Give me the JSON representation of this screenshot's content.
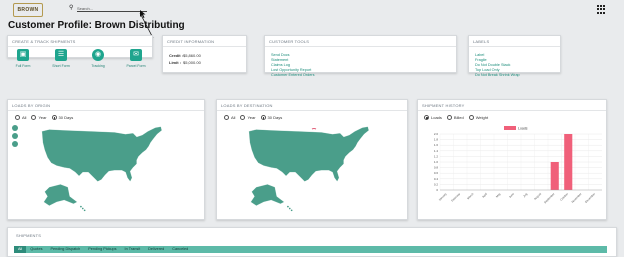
{
  "header": {
    "logo_text": "BROWN",
    "search_placeholder": "Search...",
    "page_title": "Customer Profile: Brown Distributing"
  },
  "ship_card": {
    "title": "CREATE & TRACK SHIPMENTS",
    "buttons": [
      {
        "label": "Full Form",
        "icon": "box-icon"
      },
      {
        "label": "Short Form",
        "icon": "clipboard-icon"
      },
      {
        "label": "Tracking",
        "icon": "globe-icon"
      },
      {
        "label": "Parcel Form",
        "icon": "envelope-icon"
      }
    ]
  },
  "credit_card": {
    "title": "CREDIT INFORMATION",
    "rows": [
      {
        "label": "Credit :",
        "value": "$5,860.00"
      },
      {
        "label": "Limit :",
        "value": "$5,000.00"
      }
    ]
  },
  "tools_card": {
    "title": "CUSTOMER TOOLS",
    "links": [
      "Send Docs",
      "Statement",
      "Claims Log",
      "Lost Opportunity Report",
      "Customer Entered Orders"
    ]
  },
  "labels_card": {
    "title": "LABELS",
    "links": [
      "Label",
      "Fragile",
      "Do Not Double Stack",
      "Top Load Only",
      "Do Not Break Shrink Wrap"
    ]
  },
  "origin_card": {
    "title": "LOADS BY ORIGIN",
    "radios": [
      {
        "label": "All",
        "selected": false
      },
      {
        "label": "Year",
        "selected": false
      },
      {
        "label": "30 Days",
        "selected": true
      }
    ]
  },
  "dest_card": {
    "title": "LOADS BY DESTINATION",
    "radios": [
      {
        "label": "All",
        "selected": false
      },
      {
        "label": "Year",
        "selected": false
      },
      {
        "label": "30 Days",
        "selected": true
      }
    ]
  },
  "history_card": {
    "title": "SHIPMENT HISTORY",
    "radios": [
      {
        "label": "Loads",
        "selected": true
      },
      {
        "label": "Billed",
        "selected": false
      },
      {
        "label": "Weight",
        "selected": false
      }
    ]
  },
  "chart_data": {
    "type": "bar",
    "categories": [
      "January",
      "February",
      "March",
      "April",
      "May",
      "June",
      "July",
      "August",
      "September",
      "October",
      "November",
      "December"
    ],
    "series": [
      {
        "name": "Loads",
        "values": [
          0,
          0,
          0,
          0,
          0,
          0,
          0,
          0,
          1,
          2,
          0,
          0
        ]
      }
    ],
    "ylim": [
      0,
      2.0
    ],
    "yticks": [
      "0",
      "0.2",
      "0.4",
      "0.6",
      "0.8",
      "1.0",
      "1.2",
      "1.4",
      "1.6",
      "1.8",
      "2.0"
    ],
    "bar_color": "#f0607a",
    "grid": true,
    "legend": "top-center"
  },
  "shipments": {
    "title": "SHIPMENTS",
    "tabs": [
      "All",
      "Quotes",
      "Pending Dispatch",
      "Pending Pickups",
      "In Transit",
      "Delivered",
      "Canceled"
    ],
    "active_tab": "All"
  },
  "colors": {
    "accent": "#1fa58e",
    "map": "#4a9e8a",
    "tab_bar": "#5dbaa8"
  }
}
